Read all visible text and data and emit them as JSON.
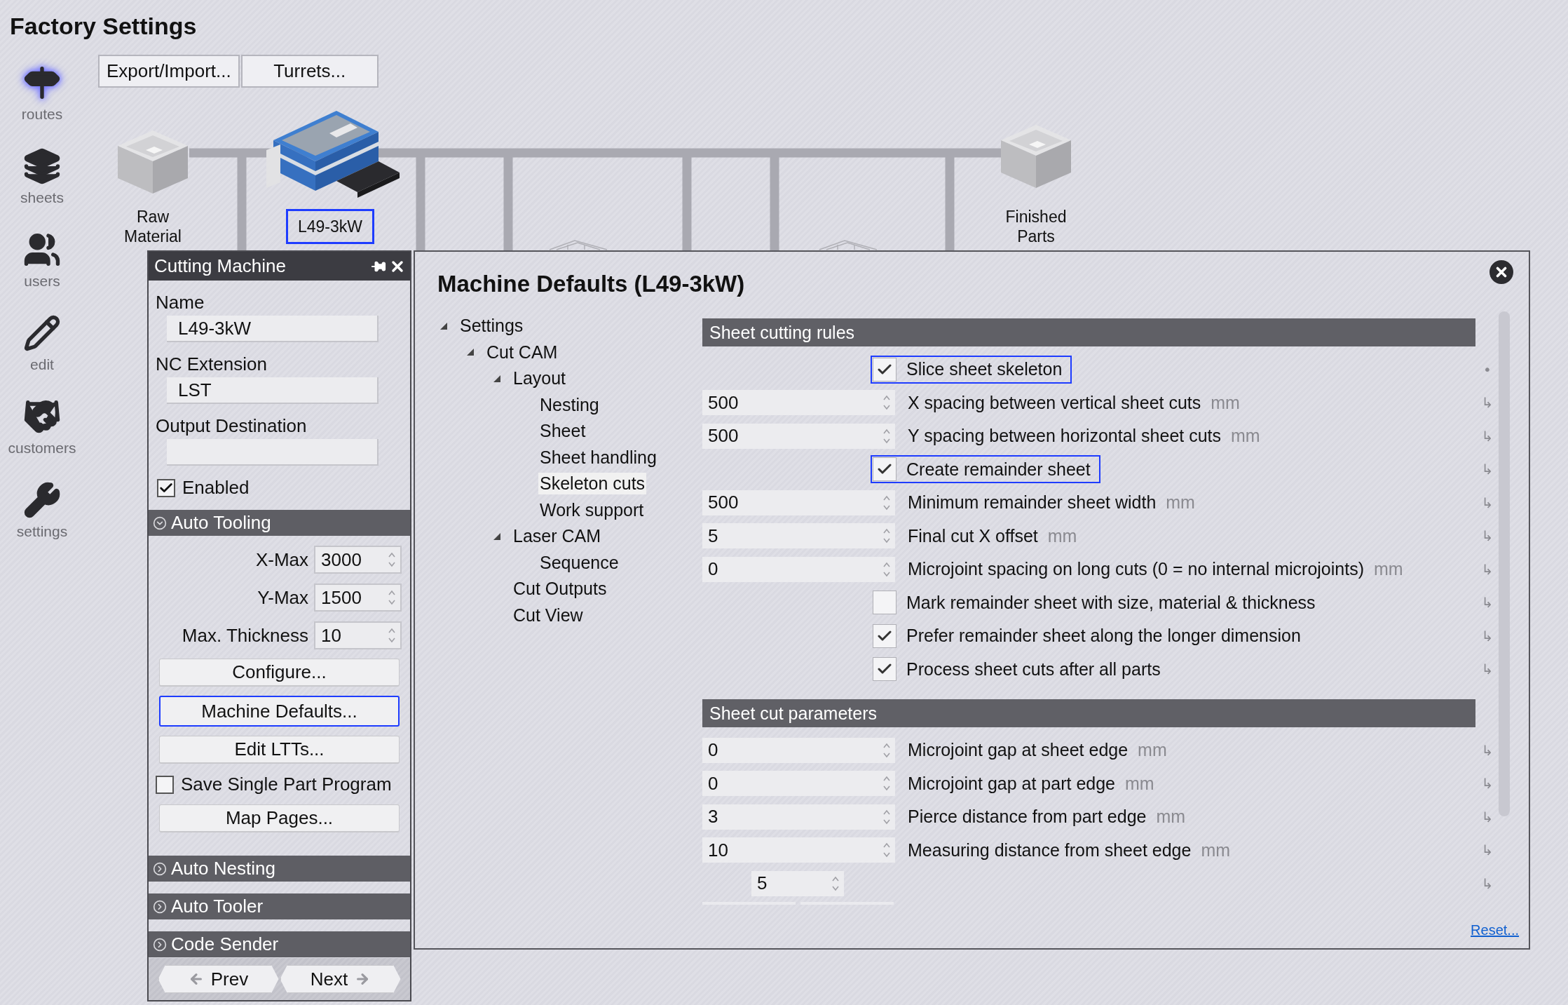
{
  "app": {
    "title": "Factory Settings"
  },
  "nav": [
    {
      "kind": "signpost",
      "label": "routes",
      "selected": true
    },
    {
      "kind": "layers",
      "label": "sheets",
      "selected": false
    },
    {
      "kind": "users",
      "label": "users",
      "selected": false
    },
    {
      "kind": "pencil",
      "label": "edit",
      "selected": false
    },
    {
      "kind": "handshake",
      "label": "customers",
      "selected": false
    },
    {
      "kind": "wrench",
      "label": "settings",
      "selected": false
    }
  ],
  "toolbar": [
    "Export/Import...",
    "Turrets..."
  ],
  "route": {
    "stations": [
      {
        "kind": "bin",
        "label": "Raw Material",
        "selected": false
      },
      {
        "kind": "machine",
        "label": "L49-3kW",
        "selected": true
      },
      {
        "kind": "bin",
        "label": "Finished Parts",
        "selected": false
      }
    ]
  },
  "machine_panel": {
    "title": "Cutting Machine",
    "fields": [
      {
        "label": "Name",
        "value": "L49-3kW"
      },
      {
        "label": "NC Extension",
        "value": "LST"
      },
      {
        "label": "Output Destination"
      }
    ],
    "enabled": {
      "label": "Enabled",
      "checked": true
    },
    "sections": [
      {
        "title": "Auto Tooling",
        "expanded": true,
        "spinners": [
          {
            "label": "X-Max",
            "value": "3000"
          },
          {
            "label": "Y-Max",
            "value": "1500"
          },
          {
            "label": "Max. Thickness",
            "value": "10"
          }
        ],
        "items": [
          {
            "kind": "button",
            "label": "Configure...",
            "focused": false
          },
          {
            "kind": "button",
            "label": "Machine Defaults...",
            "focused": true
          },
          {
            "kind": "button",
            "label": "Edit LTTs...",
            "focused": false
          },
          {
            "kind": "checkbox",
            "label": "Save Single Part Program",
            "checked": false
          },
          {
            "kind": "button",
            "label": "Map Pages...",
            "focused": false
          }
        ]
      },
      {
        "title": "Auto Nesting",
        "expanded": false
      },
      {
        "title": "Auto Tooler",
        "expanded": false
      },
      {
        "title": "Code Sender",
        "expanded": false
      }
    ],
    "pager": [
      {
        "kind": "prev",
        "label": "Prev"
      },
      {
        "kind": "next",
        "label": "Next"
      }
    ]
  },
  "dialog": {
    "title": "Machine Defaults (L49-3kW)",
    "tree": [
      {
        "label": "Settings",
        "expanded": true,
        "selected": false,
        "children": [
          {
            "label": "Cut CAM",
            "expanded": true,
            "selected": false,
            "children": [
              {
                "label": "Layout",
                "expanded": true,
                "selected": false,
                "children": [
                  {
                    "label": "Nesting",
                    "selected": false
                  },
                  {
                    "label": "Sheet",
                    "selected": false
                  },
                  {
                    "label": "Sheet handling",
                    "selected": false
                  },
                  {
                    "label": "Skeleton cuts",
                    "selected": true
                  },
                  {
                    "label": "Work support",
                    "selected": false
                  }
                ]
              },
              {
                "label": "Laser CAM",
                "expanded": true,
                "selected": false,
                "children": [
                  {
                    "label": "Sequence",
                    "selected": false
                  }
                ]
              },
              {
                "label": "Cut Outputs",
                "selected": false
              },
              {
                "label": "Cut View",
                "selected": false
              }
            ]
          }
        ]
      }
    ],
    "groups": [
      {
        "title": "Sheet cutting rules",
        "rows": [
          {
            "kind": "checkbox",
            "label": "Slice sheet skeleton",
            "checked": true,
            "focused": true,
            "marker": "•"
          },
          {
            "kind": "number",
            "value": "500",
            "label": "X spacing between vertical sheet cuts",
            "unit": "mm",
            "marker": "↳"
          },
          {
            "kind": "number",
            "value": "500",
            "label": "Y spacing between horizontal sheet cuts",
            "unit": "mm",
            "marker": "↳"
          },
          {
            "kind": "checkbox",
            "label": "Create remainder sheet",
            "checked": true,
            "focused": true,
            "marker": "↳"
          },
          {
            "kind": "number",
            "value": "500",
            "label": "Minimum remainder sheet width",
            "unit": "mm",
            "marker": "↳"
          },
          {
            "kind": "number",
            "value": "5",
            "label": "Final cut X offset",
            "unit": "mm",
            "marker": "↳"
          },
          {
            "kind": "number",
            "value": "0",
            "label": "Microjoint spacing on long cuts (0 = no internal microjoints)",
            "unit": "mm",
            "marker": "↳"
          },
          {
            "kind": "checkbox",
            "label": "Mark remainder sheet with size, material & thickness",
            "checked": false,
            "focused": false,
            "marker": "↳"
          },
          {
            "kind": "checkbox",
            "label": "Prefer remainder sheet along the longer dimension",
            "checked": true,
            "focused": false,
            "marker": "↳"
          },
          {
            "kind": "checkbox",
            "label": "Process sheet cuts after all parts",
            "checked": true,
            "focused": false,
            "marker": "↳"
          }
        ]
      },
      {
        "title": "Sheet cut parameters",
        "rows": [
          {
            "kind": "number",
            "value": "0",
            "label": "Microjoint gap at sheet edge",
            "unit": "mm",
            "marker": "↳"
          },
          {
            "kind": "number",
            "value": "0",
            "label": "Microjoint gap at part edge",
            "unit": "mm",
            "marker": "↳"
          },
          {
            "kind": "number",
            "value": "3",
            "label": "Pierce distance from part edge",
            "unit": "mm",
            "marker": "↳"
          },
          {
            "kind": "number",
            "value": "10",
            "label": "Measuring distance from sheet edge",
            "unit": "mm",
            "marker": "↳"
          },
          {
            "kind": "small_number",
            "value": "5",
            "marker": "↳"
          }
        ]
      }
    ],
    "reset": "Reset..."
  }
}
